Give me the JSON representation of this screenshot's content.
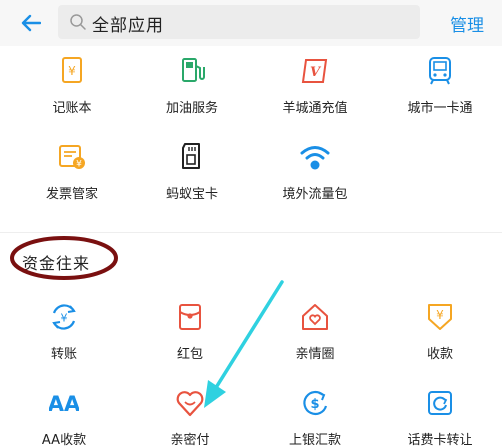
{
  "header": {
    "search_text": "全部应用",
    "manage_label": "管理"
  },
  "apps_top": [
    {
      "label": "记账本",
      "icon": "ledger-icon"
    },
    {
      "label": "加油服务",
      "icon": "gas-station-icon"
    },
    {
      "label": "羊城通充值",
      "icon": "transit-recharge-icon"
    },
    {
      "label": "城市一卡通",
      "icon": "city-card-icon"
    },
    {
      "label": "发票管家",
      "icon": "invoice-icon"
    },
    {
      "label": "蚂蚁宝卡",
      "icon": "sim-card-icon"
    },
    {
      "label": "境外流量包",
      "icon": "wifi-icon"
    }
  ],
  "section": {
    "title": "资金往来"
  },
  "apps_funds": [
    {
      "label": "转账",
      "icon": "transfer-icon"
    },
    {
      "label": "红包",
      "icon": "red-packet-icon"
    },
    {
      "label": "亲情圈",
      "icon": "family-icon"
    },
    {
      "label": "收款",
      "icon": "receive-money-icon"
    },
    {
      "label": "AA收款",
      "icon": "aa-icon"
    },
    {
      "label": "亲密付",
      "icon": "heart-pay-icon"
    },
    {
      "label": "上银汇款",
      "icon": "remittance-icon"
    },
    {
      "label": "话费卡转让",
      "icon": "phone-card-icon"
    }
  ],
  "colors": {
    "accent_blue": "#1a8fe6",
    "orange": "#f5a623",
    "green": "#2aa86a",
    "red": "#e8533f",
    "annotation_circle": "#7a1010",
    "annotation_arrow": "#2fd1e0"
  }
}
